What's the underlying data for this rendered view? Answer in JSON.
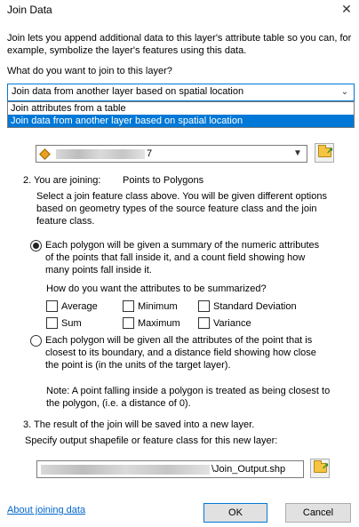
{
  "window": {
    "title": "Join Data",
    "close_icon": "close-icon"
  },
  "intro": "Join lets you append additional data to this layer's attribute table so you can, for example, symbolize the layer's features using this data.",
  "question": "What do you want to join to this layer?",
  "join_type": {
    "selected": "Join data from another layer based on spatial location",
    "options": [
      "Join attributes from a table",
      "Join data from another layer based on spatial location"
    ],
    "highlighted_index": 1
  },
  "step1": {
    "layer_value_suffix": "7"
  },
  "step2": {
    "label": "2.  You are joining:",
    "join_kind": "Points to Polygons",
    "description": "Select a join feature class above.  You will be given different options based on geometry types of the source feature class and the join feature class.",
    "option_summary": {
      "text": "Each polygon will be given a summary of the numeric attributes of the points that fall inside it, and a count field showing how many points fall inside it.",
      "selected": true
    },
    "summarize_question": "How do you want the attributes to be summarized?",
    "stats": [
      "Average",
      "Minimum",
      "Standard Deviation",
      "Sum",
      "Maximum",
      "Variance"
    ],
    "option_closest": {
      "text": "Each polygon will be given all the attributes of the point that is closest to its boundary, and a distance field showing how close the point is (in the units of the target layer).",
      "selected": false
    },
    "note": "Note: A point falling inside a polygon is treated as being closest to the polygon, (i.e. a distance of 0)."
  },
  "step3": {
    "label": "3.  The result of the join will be saved into a new layer.",
    "prompt": "Specify output shapefile or feature class for this new layer:",
    "output_suffix": "\\Join_Output.shp"
  },
  "footer": {
    "help_link": "About joining data",
    "ok": "OK",
    "cancel": "Cancel"
  },
  "colors": {
    "accent": "#0078d7",
    "link": "#0066cc"
  }
}
